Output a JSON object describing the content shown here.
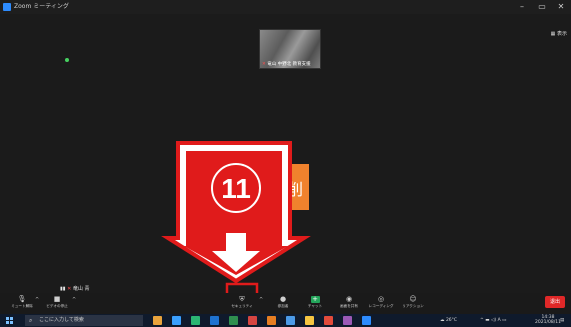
{
  "window": {
    "title": "Zoom ミーティング",
    "controls": [
      "–",
      "▭",
      "✕"
    ],
    "view_label": "表示"
  },
  "participants": {
    "thumbnail_name": "竜山 中野北 教育支援",
    "self_name": "竜山 青"
  },
  "overlay": {
    "side_text": "削",
    "step_number": "11"
  },
  "toolbar": {
    "items": [
      {
        "label": "ミュート解除",
        "icon": "microphone-muted-icon"
      },
      {
        "label": "ビデオの停止",
        "icon": "camera-icon"
      },
      {
        "label": "セキュリティ",
        "icon": "shield-icon"
      },
      {
        "label": "参加者",
        "icon": "participants-icon"
      },
      {
        "label": "チャット",
        "icon": "chat-icon"
      },
      {
        "label": "画面を共有",
        "icon": "share-screen-icon"
      },
      {
        "label": "レコーディング",
        "icon": "record-icon"
      },
      {
        "label": "リアクション",
        "icon": "reaction-icon"
      }
    ],
    "leave_label": "退出"
  },
  "taskbar": {
    "search_placeholder": "ここに入力して検索",
    "weather": "26°C",
    "ime": "A",
    "time": "14:38",
    "date": "2021/08/11",
    "app_colors": [
      "#e8a33d",
      "#3aa0ff",
      "#2bb673",
      "#1e72d0",
      "#2f8f4f",
      "#d64541",
      "#e67e22",
      "#4c9be8",
      "#f5c542",
      "#e24b3b",
      "#9b59b6",
      "#2d8cff"
    ]
  }
}
